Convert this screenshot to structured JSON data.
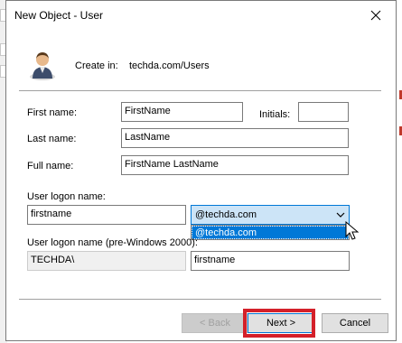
{
  "window": {
    "title": "New Object - User"
  },
  "header": {
    "create_in_label": "Create in:",
    "create_in_path": "techda.com/Users"
  },
  "form": {
    "first_name_label": "First name:",
    "first_name_value": "FirstName",
    "initials_label": "Initials:",
    "initials_value": "",
    "last_name_label": "Last name:",
    "last_name_value": "LastName",
    "full_name_label": "Full name:",
    "full_name_value": "FirstName LastName",
    "logon_label": "User logon name:",
    "logon_value": "firstname",
    "domain_selected": "@techda.com",
    "domain_options": [
      "@techda.com"
    ],
    "pre2000_label": "User logon name (pre-Windows 2000):",
    "pre2000_domain": "TECHDA\\",
    "pre2000_value": "firstname"
  },
  "buttons": {
    "back": "< Back",
    "next": "Next >",
    "cancel": "Cancel"
  },
  "colors": {
    "accent": "#0078d7",
    "highlight": "#d4202a"
  },
  "icons": {
    "user": "user-icon",
    "close": "close-icon",
    "dropdown": "chevron-down-icon",
    "cursor": "mouse-cursor-icon"
  }
}
